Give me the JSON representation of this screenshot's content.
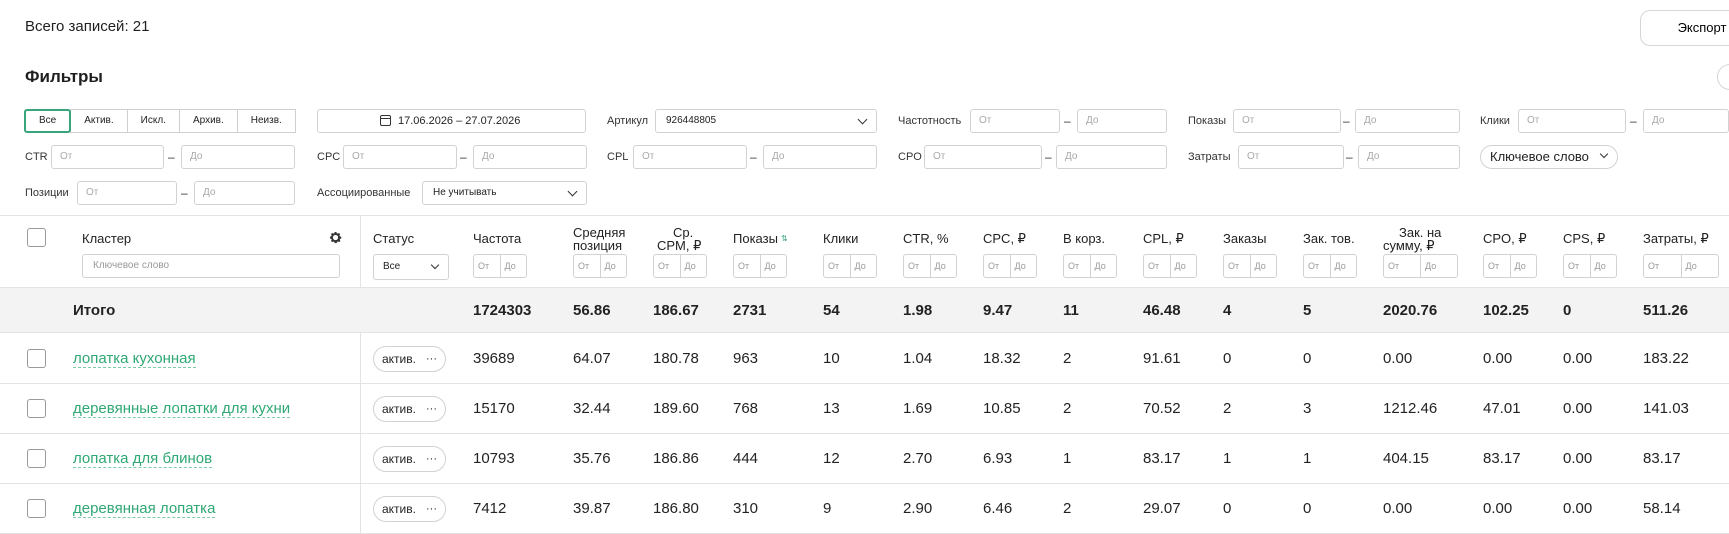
{
  "header": {
    "records_count": "Всего записей: 21",
    "export_label": "Экспорт"
  },
  "filters": {
    "title": "Фильтры",
    "status_tabs": [
      "Все",
      "Актив.",
      "Искл.",
      "Архив.",
      "Неизв."
    ],
    "date_range": "17.06.2026 – 27.07.2026",
    "article_label": "Артикул",
    "article_value": "926448805",
    "frequency_label": "Частотность",
    "shows_label": "Показы",
    "clicks_label": "Клики",
    "ctr_label": "CTR",
    "cpc_label": "CPC",
    "cpl_label": "CPL",
    "cpo_label": "CPO",
    "costs_label": "Затраты",
    "keyword_pill": "Ключевое слово",
    "positions_label": "Позиции",
    "associated_label": "Ассоциированные",
    "associated_value": "Не учитывать",
    "from_placeholder": "От",
    "to_placeholder": "До",
    "dash": "–"
  },
  "table": {
    "columns": {
      "cluster": "Кластер",
      "status": "Статус",
      "freq": "Частота",
      "avgpos_1": "Средняя",
      "avgpos_2": "позиция",
      "cpm_1": "Ср.",
      "cpm_2": "CPM, ₽",
      "shows": "Показы",
      "clicks": "Клики",
      "ctr": "CTR, %",
      "cpc": "CPC, ₽",
      "cart": "В корз.",
      "cpl": "CPL, ₽",
      "orders": "Заказы",
      "ordgoods": "Зак. тов.",
      "ordsum_1": "Зак. на",
      "ordsum_2": "сумму, ₽",
      "cpo": "CPO, ₽",
      "cps": "CPS, ₽",
      "costs": "Затраты, ₽"
    },
    "keyword_placeholder": "Ключевое слово",
    "status_filter_value": "Все",
    "mini_from": "От",
    "mini_to": "До",
    "sort_icon": "⇅",
    "totals": {
      "label": "Итого",
      "freq": "1724303",
      "avgpos": "56.86",
      "cpm": "186.67",
      "shows": "2731",
      "clicks": "54",
      "ctr": "1.98",
      "cpc": "9.47",
      "cart": "11",
      "cpl": "46.48",
      "orders": "4",
      "ordgoods": "5",
      "ordsum": "2020.76",
      "cpo": "102.25",
      "cps": "0",
      "costs": "511.26"
    },
    "rows": [
      {
        "keyword": "лопатка кухонная",
        "status": "актив.",
        "freq": "39689",
        "avgpos": "64.07",
        "cpm": "180.78",
        "shows": "963",
        "clicks": "10",
        "ctr": "1.04",
        "cpc": "18.32",
        "cart": "2",
        "cpl": "91.61",
        "orders": "0",
        "ordgoods": "0",
        "ordsum": "0.00",
        "cpo": "0.00",
        "cps": "0.00",
        "costs": "183.22"
      },
      {
        "keyword": "деревянные лопатки для кухни",
        "status": "актив.",
        "freq": "15170",
        "avgpos": "32.44",
        "cpm": "189.60",
        "shows": "768",
        "clicks": "13",
        "ctr": "1.69",
        "cpc": "10.85",
        "cart": "2",
        "cpl": "70.52",
        "orders": "2",
        "ordgoods": "3",
        "ordsum": "1212.46",
        "cpo": "47.01",
        "cps": "0.00",
        "costs": "141.03"
      },
      {
        "keyword": "лопатка для блинов",
        "status": "актив.",
        "freq": "10793",
        "avgpos": "35.76",
        "cpm": "186.86",
        "shows": "444",
        "clicks": "12",
        "ctr": "2.70",
        "cpc": "6.93",
        "cart": "1",
        "cpl": "83.17",
        "orders": "1",
        "ordgoods": "1",
        "ordsum": "404.15",
        "cpo": "83.17",
        "cps": "0.00",
        "costs": "83.17"
      },
      {
        "keyword": "деревянная лопатка",
        "status": "актив.",
        "freq": "7412",
        "avgpos": "39.87",
        "cpm": "186.80",
        "shows": "310",
        "clicks": "9",
        "ctr": "2.90",
        "cpc": "6.46",
        "cart": "2",
        "cpl": "29.07",
        "orders": "0",
        "ordgoods": "0",
        "ordsum": "0.00",
        "cpo": "0.00",
        "cps": "0.00",
        "costs": "58.14"
      }
    ]
  },
  "icons": {
    "accent": "#3aa57c",
    "link": "#2fa874"
  }
}
